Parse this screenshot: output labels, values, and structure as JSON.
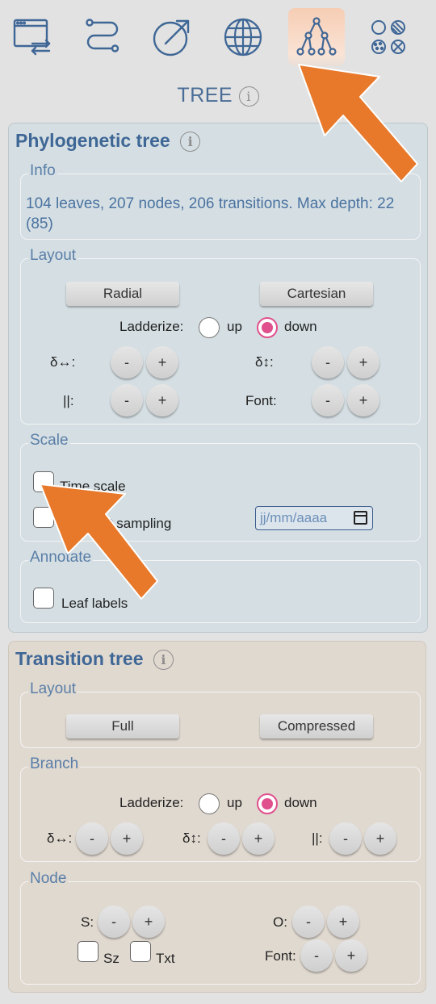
{
  "toolbar": {
    "icons": [
      {
        "name": "window-transfer-icon",
        "active": false
      },
      {
        "name": "path-icon",
        "active": false
      },
      {
        "name": "export-arrow-icon",
        "active": false
      },
      {
        "name": "globe-icon",
        "active": false
      },
      {
        "name": "tree-icon",
        "active": true
      },
      {
        "name": "patterns-icon",
        "active": false
      }
    ]
  },
  "section_title": "TREE",
  "phylogenetic": {
    "title": "Phylogenetic tree",
    "info": {
      "legend": "Info",
      "text": "104 leaves, 207 nodes, 206 transitions. Max depth: 22 (85)"
    },
    "layout": {
      "legend": "Layout",
      "radial": "Radial",
      "cartesian": "Cartesian",
      "ladderize": "Ladderize:",
      "up": "up",
      "down": "down",
      "ladderize_value": "down",
      "horiz_label": "δ↔:",
      "vert_label": "δ↕:",
      "width_label": "||:",
      "font_label": "Font:",
      "minus": "-",
      "plus": "+"
    },
    "scale": {
      "legend": "Scale",
      "time_scale": "Time scale",
      "recent_sampling": "ecent sampling",
      "date_placeholder": "jj/mm/aaaa"
    },
    "annotate": {
      "legend": "Annotate",
      "leaf_labels": "Leaf labels"
    }
  },
  "transition": {
    "title": "Transition tree",
    "layout": {
      "legend": "Layout",
      "full": "Full",
      "compressed": "Compressed"
    },
    "branch": {
      "legend": "Branch",
      "ladderize": "Ladderize:",
      "up": "up",
      "down": "down",
      "horiz_label": "δ↔:",
      "vert_label": "δ↕:",
      "width_label": "||:",
      "minus": "-",
      "plus": "+"
    },
    "node": {
      "legend": "Node",
      "s_label": "S:",
      "o_label": "O:",
      "sz": "Sz",
      "txt": "Txt",
      "font_label": "Font:",
      "minus": "-",
      "plus": "+"
    }
  },
  "colors": {
    "accent": "#4a6d98",
    "arrow": "#e8782a",
    "radio_checked": "#e0508d"
  }
}
